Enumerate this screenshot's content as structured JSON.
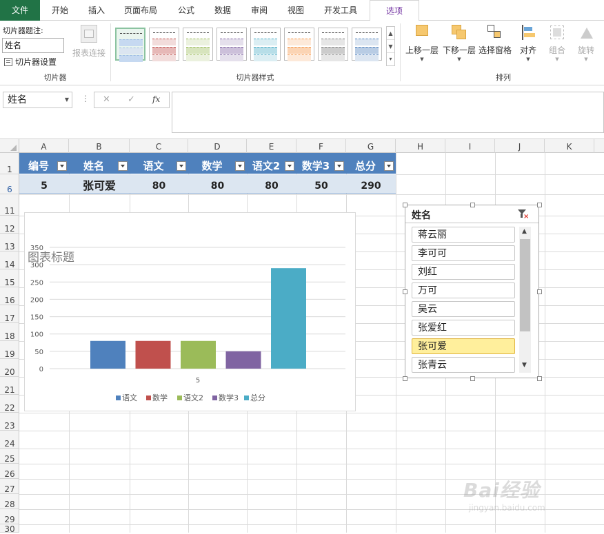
{
  "tabs": {
    "file": "文件",
    "home": "开始",
    "insert": "插入",
    "layout": "页面布局",
    "formula": "公式",
    "data": "数据",
    "review": "审阅",
    "view": "视图",
    "dev": "开发工具",
    "options": "选项"
  },
  "ribbon": {
    "caption_label": "切片器题注:",
    "caption_value": "姓名",
    "settings_label": "切片器设置",
    "report_conn_label": "报表连接",
    "group_slicer": "切片器",
    "group_styles": "切片器样式",
    "group_arrange": "排列",
    "bring_forward": "上移一层",
    "send_backward": "下移一层",
    "selection_pane": "选择窗格",
    "align": "对齐",
    "group": "组合",
    "rotate": "旋转"
  },
  "formula_bar": {
    "name_box": "姓名",
    "fx": "fx",
    "cancel": "✕",
    "enter": "✓"
  },
  "columns": [
    "A",
    "B",
    "C",
    "D",
    "E",
    "F",
    "G",
    "H",
    "I",
    "J",
    "K"
  ],
  "rows": [
    "1",
    "6",
    "11",
    "12",
    "13",
    "14",
    "15",
    "16",
    "17",
    "18",
    "19",
    "20",
    "21",
    "22",
    "23",
    "24",
    "25",
    "26",
    "27",
    "28",
    "29",
    "30"
  ],
  "table": {
    "headers": [
      "编号",
      "姓名",
      "语文",
      "数学",
      "语文2",
      "数学3",
      "总分"
    ],
    "row": [
      "5",
      "张可爱",
      "80",
      "80",
      "80",
      "50",
      "290"
    ]
  },
  "chart_data": {
    "type": "bar",
    "title": "图表标题",
    "categories": [
      "5"
    ],
    "series": [
      {
        "name": "语文",
        "values": [
          80
        ],
        "color": "#4f81bd"
      },
      {
        "name": "数学",
        "values": [
          80
        ],
        "color": "#c0504d"
      },
      {
        "name": "语文2",
        "values": [
          80
        ],
        "color": "#9bbb59"
      },
      {
        "name": "数学3",
        "values": [
          50
        ],
        "color": "#8064a2"
      },
      {
        "name": "总分",
        "values": [
          290
        ],
        "color": "#4bacc6"
      }
    ],
    "ylim": [
      0,
      350
    ],
    "yticks": [
      "0",
      "50",
      "100",
      "150",
      "200",
      "250",
      "300",
      "350"
    ],
    "grid": true,
    "legend": "bottom"
  },
  "slicer": {
    "title": "姓名",
    "items": [
      {
        "label": "蒋云丽",
        "selected": false
      },
      {
        "label": "李可可",
        "selected": false
      },
      {
        "label": "刘红",
        "selected": false
      },
      {
        "label": "万可",
        "selected": false
      },
      {
        "label": "吴云",
        "selected": false
      },
      {
        "label": "张爱红",
        "selected": false
      },
      {
        "label": "张可爱",
        "selected": true
      },
      {
        "label": "张青云",
        "selected": false
      }
    ]
  },
  "watermark": {
    "brand": "Bai经验",
    "url": "jingyan.baidu.com"
  }
}
